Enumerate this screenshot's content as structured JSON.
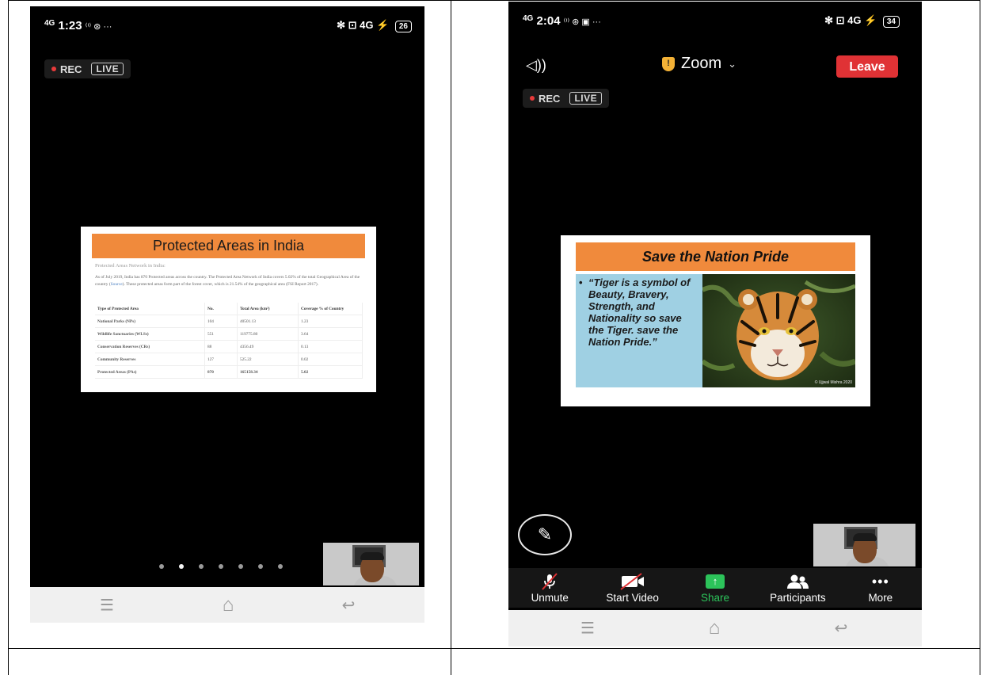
{
  "left_screen": {
    "status": {
      "network": "4G",
      "time": "1:23",
      "extra": "⁽ⁱ⁾ ⊛ ···",
      "right": "✻ ⊡ 4G ⚡",
      "battery": "26"
    },
    "recording": {
      "rec_label": "REC",
      "live_label": "LIVE"
    },
    "slide": {
      "title": "Protected Areas in India",
      "subtitle": "Protected Areas Network in India:",
      "paragraph_start": "As of July 2019, India has 870 Protected areas across the country. The Protected Area Network of India covers 5.02% of the total Geographical Area of the country (",
      "paragraph_link": "Source",
      "paragraph_end": "). These protected areas form part of the forest cover, which is 21.54% of the geographical area (FSI Report 2017).",
      "table": {
        "headers": [
          "Type of Protected Area",
          "No.",
          "Total Area (km²)",
          "Coverage % of Country"
        ],
        "rows": [
          [
            "National Parks (NPs)",
            "104",
            "40501.13",
            "1.23"
          ],
          [
            "Wildlife Sanctuaries (WLSs)",
            "551",
            "119775.80",
            "3.64"
          ],
          [
            "Conservation Reserves (CRs)",
            "88",
            "4356.49",
            "0.13"
          ],
          [
            "Community Reserves",
            "127",
            "525.22",
            "0.02"
          ],
          [
            "Protected Areas (PAs)",
            "870",
            "165158.34",
            "5.02"
          ]
        ]
      }
    },
    "pager": {
      "count": 7,
      "active_index": 1
    },
    "nav": {
      "menu": "☰",
      "home": "⌂",
      "back": "↩"
    }
  },
  "right_screen": {
    "status": {
      "network": "4G",
      "time": "2:04",
      "extra": "⁽ⁱ⁾ ⊛ ▣ ···",
      "right": "✻ ⊡ 4G ⚡",
      "battery": "34"
    },
    "header": {
      "speaker_icon": "◁))",
      "meeting_name": "Zoom",
      "chevron": "⌄",
      "leave_label": "Leave"
    },
    "recording": {
      "rec_label": "REC",
      "live_label": "LIVE"
    },
    "slide": {
      "title": "Save the Nation Pride",
      "bullet": "•",
      "quote": "“Tiger is a symbol of Beauty, Bravery, Strength, and Nationality so save the Tiger. save the Nation Pride.”",
      "image_caption": "© Ujjwal Mishra 2020"
    },
    "toolbar": [
      {
        "label": "Unmute",
        "icon": "mic-muted-icon"
      },
      {
        "label": "Start Video",
        "icon": "video-off-icon"
      },
      {
        "label": "Share",
        "icon": "share-icon",
        "color": "#2cc35a"
      },
      {
        "label": "Participants",
        "icon": "participants-icon"
      },
      {
        "label": "More",
        "icon": "more-icon"
      }
    ],
    "nav": {
      "menu": "☰",
      "home": "⌂",
      "back": "↩"
    }
  },
  "colors": {
    "slide_title_bg": "#f08a3c",
    "quote_bg": "#9fd0e3",
    "leave_bg": "#e03235",
    "share_green": "#2cc35a",
    "rec_dot": "#e83a3a"
  }
}
